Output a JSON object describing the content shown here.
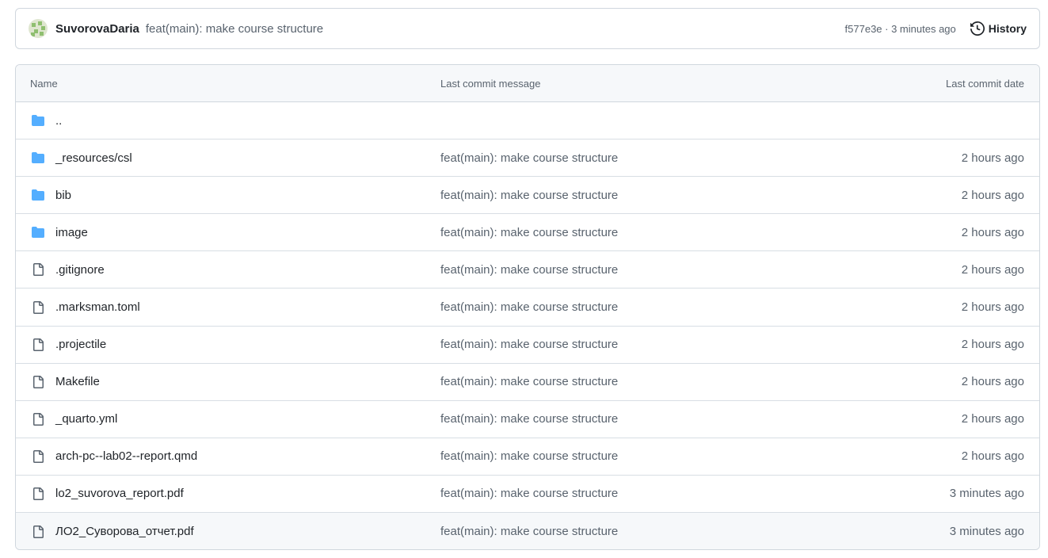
{
  "commit_bar": {
    "author": "SuvorovaDaria",
    "message": "feat(main): make course structure",
    "sha_time": "f577e3e · 3 minutes ago",
    "history_label": "History"
  },
  "table": {
    "headers": {
      "name": "Name",
      "message": "Last commit message",
      "date": "Last commit date"
    },
    "rows": [
      {
        "name": "..",
        "type": "folder",
        "message": "",
        "date": ""
      },
      {
        "name": "_resources/csl",
        "type": "folder",
        "message": "feat(main): make course structure",
        "date": "2 hours ago"
      },
      {
        "name": "bib",
        "type": "folder",
        "message": "feat(main): make course structure",
        "date": "2 hours ago"
      },
      {
        "name": "image",
        "type": "folder",
        "message": "feat(main): make course structure",
        "date": "2 hours ago"
      },
      {
        "name": ".gitignore",
        "type": "file",
        "message": "feat(main): make course structure",
        "date": "2 hours ago"
      },
      {
        "name": ".marksman.toml",
        "type": "file",
        "message": "feat(main): make course structure",
        "date": "2 hours ago"
      },
      {
        "name": ".projectile",
        "type": "file",
        "message": "feat(main): make course structure",
        "date": "2 hours ago"
      },
      {
        "name": "Makefile",
        "type": "file",
        "message": "feat(main): make course structure",
        "date": "2 hours ago"
      },
      {
        "name": "_quarto.yml",
        "type": "file",
        "message": "feat(main): make course structure",
        "date": "2 hours ago"
      },
      {
        "name": "arch-pc--lab02--report.qmd",
        "type": "file",
        "message": "feat(main): make course structure",
        "date": "2 hours ago"
      },
      {
        "name": "lo2_suvorova_report.pdf",
        "type": "file",
        "message": "feat(main): make course structure",
        "date": "3 minutes ago"
      },
      {
        "name": "ЛО2_Суворова_отчет.pdf",
        "type": "file",
        "message": "feat(main): make course structure",
        "date": "3 minutes ago"
      }
    ]
  },
  "colors": {
    "folder": "#54aeff",
    "file_icon": "#59636e",
    "border": "#d0d7de",
    "header_bg": "#f6f8fa"
  }
}
